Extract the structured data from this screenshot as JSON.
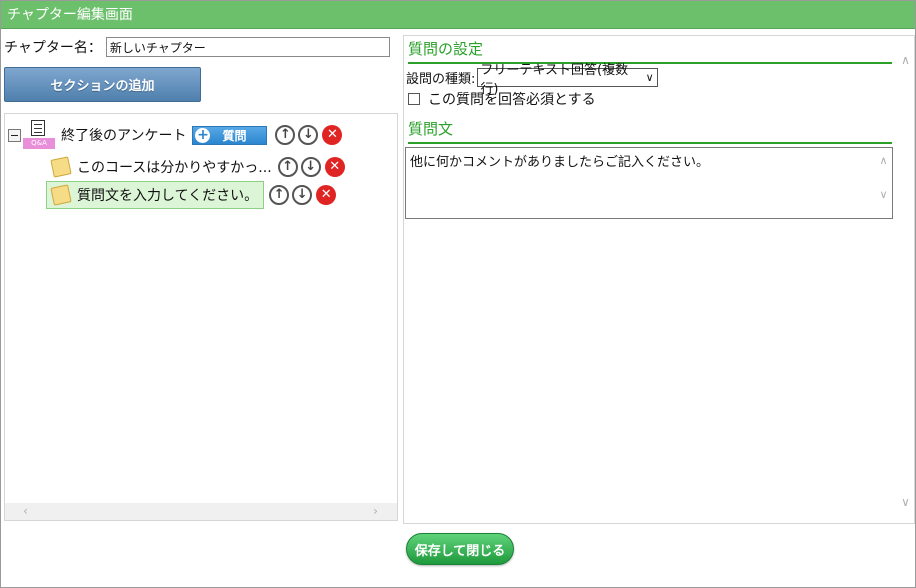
{
  "window": {
    "title": "チャプター編集画面"
  },
  "chapter": {
    "label": "チャプター名：",
    "name_value": "新しいチャプター"
  },
  "toolbar": {
    "add_section_label": "セクションの追加"
  },
  "tree": {
    "root": {
      "label": "終了後のアンケート",
      "icon_tag": "Q&A",
      "add_question_label": "質問"
    },
    "children": [
      {
        "label": "このコースは分かりやすかっ..."
      },
      {
        "label": "質問文を入力してください。",
        "selected": true
      }
    ]
  },
  "settings": {
    "section_title": "質問の設定",
    "type_label": "設問の種類:",
    "type_value": "フリーテキスト回答(複数行)",
    "required_label": "この質問を回答必須とする",
    "required_checked": false
  },
  "question": {
    "section_title": "質問文",
    "text": "他に何かコメントがありましたらご記入ください。"
  },
  "footer": {
    "save_close_label": "保存して閉じる"
  },
  "colors": {
    "title_bar": "#6cc06c",
    "accent_green": "#2aa02a",
    "question_blue": "#2b86cf",
    "delete_red": "#e02424"
  }
}
